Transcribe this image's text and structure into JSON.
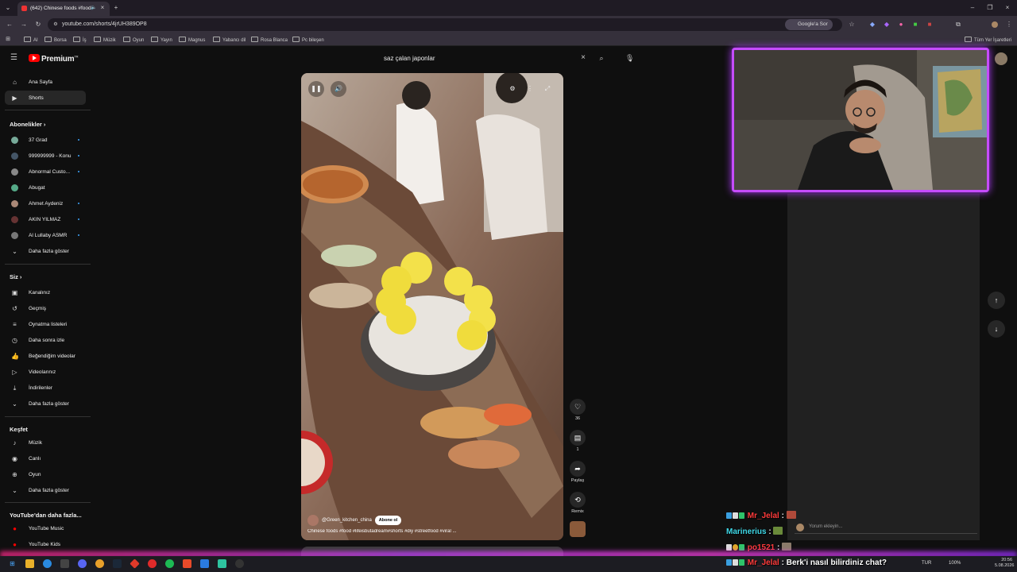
{
  "browser": {
    "tab_title": "(642) Chinese foods #food",
    "url": "youtube.com/shorts/4jrUH389OP8",
    "google_button": "Google'a Sor",
    "bookmarks": [
      "AI",
      "Borsa",
      "İş",
      "Müzik",
      "Oyun",
      "Yayın",
      "Magnus",
      "Yabancı dil",
      "Rosa Blanca",
      "Pc bileşen"
    ],
    "all_bookmarks": "Tüm Yer İşaretleri"
  },
  "youtube": {
    "logo": "Premium",
    "logo_sup": "TR",
    "search_value": "saz çalan japonlar"
  },
  "sidebar": {
    "home": "Ana Sayfa",
    "shorts": "Shorts",
    "subscriptions_header": "Abonelikler",
    "subscriptions": [
      "37 Grad",
      "999999999 - Konu",
      "Abnormal Custo...",
      "Abugat",
      "Ahmet Aydeniz",
      "AKIN YILMAZ",
      "Al Lullaby ASMR"
    ],
    "show_more": "Daha fazla göster",
    "you_header": "Siz",
    "you_items": [
      "Kanalınız",
      "Geçmiş",
      "Oynatma listeleri",
      "Daha sonra izle",
      "Beğendiğim videolar",
      "Videolarınız",
      "İndirilenler"
    ],
    "explore_header": "Keşfet",
    "explore_items": [
      "Müzik",
      "Canlı",
      "Oyun"
    ],
    "more_header": "YouTube'dan daha fazla...",
    "more_items": [
      "YouTube Music",
      "YouTube Kids"
    ]
  },
  "video": {
    "channel": "@Green_kitchen_china",
    "subscribe": "Abone ol",
    "title": "Chinese foods #food #lifeisbutadream#shorts #diy #streetfood #viral ..."
  },
  "actions": {
    "likes": "36",
    "comments": "1",
    "share": "Paylaş",
    "remix": "Remix"
  },
  "comment_placeholder": "Yorum ekleyin...",
  "chat": [
    {
      "user": "Mr_Jelal",
      "sep": ":",
      "msg": "",
      "color": "#ff3b3b"
    },
    {
      "user": "Marinerius",
      "sep": ":",
      "msg": "",
      "color": "#3fd9e8"
    },
    {
      "user": "po1521",
      "sep": ":",
      "msg": "",
      "color": "#ff3b3b"
    },
    {
      "user": "Mr_Jelal",
      "sep": ":",
      "msg": "Berk'i nasıl bilirdiniz chat?",
      "color": "#ff3b3b"
    }
  ],
  "taskbar": {
    "lang": "TUR",
    "battery": "100%",
    "time": "20:56",
    "date": "5.08.2026"
  }
}
